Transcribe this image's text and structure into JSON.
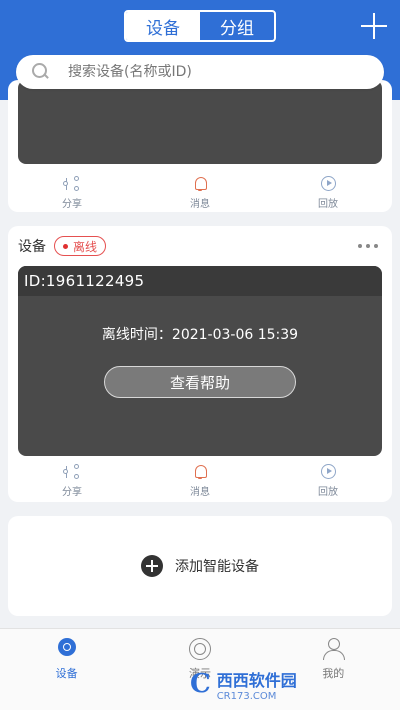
{
  "header": {
    "tabs": [
      {
        "label": "设备",
        "active": true
      },
      {
        "label": "分组",
        "active": false
      }
    ]
  },
  "search": {
    "placeholder": "搜索设备(名称或ID)",
    "value": ""
  },
  "actions": {
    "share": "分享",
    "message": "消息",
    "playback": "回放"
  },
  "device_card": {
    "name": "设备",
    "status": "离线",
    "id_text": "ID:1961122495",
    "offline_time": "离线时间：2021-03-06 15:39",
    "help_button": "查看帮助"
  },
  "add_device": {
    "label": "添加智能设备"
  },
  "tabbar": {
    "items": [
      {
        "label": "设备",
        "icon": "camera-icon",
        "active": true
      },
      {
        "label": "演示",
        "icon": "demo-icon",
        "active": false
      },
      {
        "label": "我的",
        "icon": "user-icon",
        "active": false
      }
    ]
  },
  "watermark": {
    "logo": "C",
    "name": "西西软件园",
    "site": "CR173.COM"
  },
  "colors": {
    "primary": "#2f6fd6",
    "offline": "#e55050",
    "card_dark": "#4a4a4a"
  }
}
